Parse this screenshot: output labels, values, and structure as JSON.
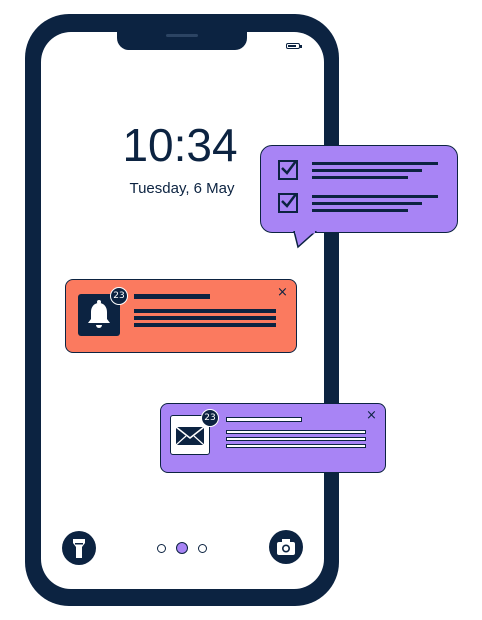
{
  "lockscreen": {
    "time": "10:34",
    "date": "Tuesday, 6 May"
  },
  "notifications": {
    "reminder": {
      "badge": "23",
      "close": "×"
    },
    "mail": {
      "badge": "23",
      "close": "×"
    }
  },
  "pager": {
    "count": 3,
    "active_index": 1
  },
  "colors": {
    "navy": "#0c2341",
    "purple": "#a884f5",
    "orange": "#fb7a5f",
    "white": "#ffffff"
  },
  "icons": [
    "battery-icon",
    "checkbox-icon",
    "bell-icon",
    "mail-icon",
    "flashlight-icon",
    "camera-icon",
    "close-icon"
  ]
}
